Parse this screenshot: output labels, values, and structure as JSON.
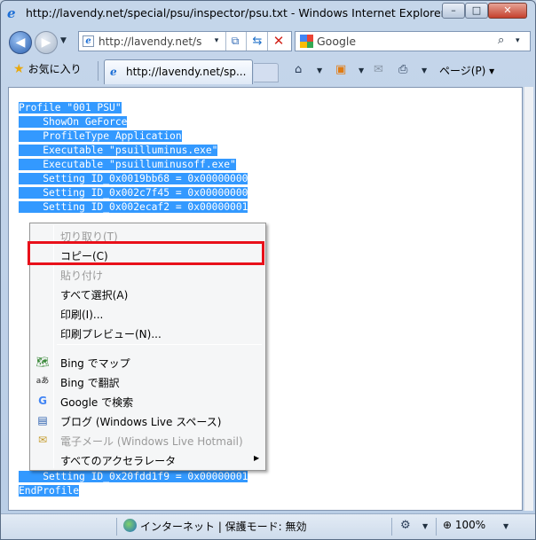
{
  "window": {
    "title": "http://lavendy.net/special/psu/inspector/psu.txt - Windows Internet Explorer",
    "min_label": "–",
    "max_label": "□",
    "close_label": "✕"
  },
  "address": {
    "value": "http://lavendy.net/s",
    "drop": "▾"
  },
  "search": {
    "placeholder": "Google",
    "go": "⌕",
    "drop": "▾"
  },
  "favorites": {
    "label": "お気に入り"
  },
  "tab": {
    "title": "http://lavendy.net/sp..."
  },
  "command": {
    "page_label": "ページ(P) ▾"
  },
  "content_lines": [
    "Profile \"001 PSU\"",
    "    ShowOn GeForce",
    "    ProfileType Application",
    "    Executable \"psuilluminus.exe\"",
    "    Executable \"psuilluminusoff.exe\"",
    "    Setting ID_0x0019bb68 = 0x00000000",
    "    Setting ID_0x002c7f45 = 0x00000000",
    "    Setting ID_0x002ecaf2 = 0x00000001",
    "    Setting ID_0x20fdd1f9 = 0x00000001",
    "EndProfile"
  ],
  "context_menu": {
    "items": [
      {
        "label": "切り取り(T)",
        "disabled": true
      },
      {
        "label": "コピー(C)",
        "disabled": false
      },
      {
        "label": "貼り付け",
        "disabled": true
      },
      {
        "label": "すべて選択(A)",
        "disabled": false
      },
      {
        "label": "印刷(I)...",
        "disabled": false
      },
      {
        "label": "印刷プレビュー(N)...",
        "disabled": false
      },
      {
        "label": "Bing でマップ",
        "disabled": false,
        "icon": "map-icon"
      },
      {
        "label": "Bing で翻訳",
        "disabled": false,
        "icon": "translate-icon"
      },
      {
        "label": "Google で検索",
        "disabled": false,
        "icon": "google-icon"
      },
      {
        "label": "ブログ (Windows Live スペース)",
        "disabled": false,
        "icon": "blog-icon"
      },
      {
        "label": "電子メール (Windows Live Hotmail)",
        "disabled": true,
        "icon": "mail-icon"
      },
      {
        "label": "すべてのアクセラレータ",
        "disabled": false,
        "submenu": true
      }
    ]
  },
  "status": {
    "zone": "インターネット | 保護モード: 無効",
    "zoom": "100%"
  },
  "colors": {
    "selection": "#3399ff",
    "highlight_box": "#e8101a",
    "google_blue": "#4285f4",
    "google_red": "#ea4335",
    "google_yellow": "#fbbc05",
    "google_green": "#34a853"
  }
}
